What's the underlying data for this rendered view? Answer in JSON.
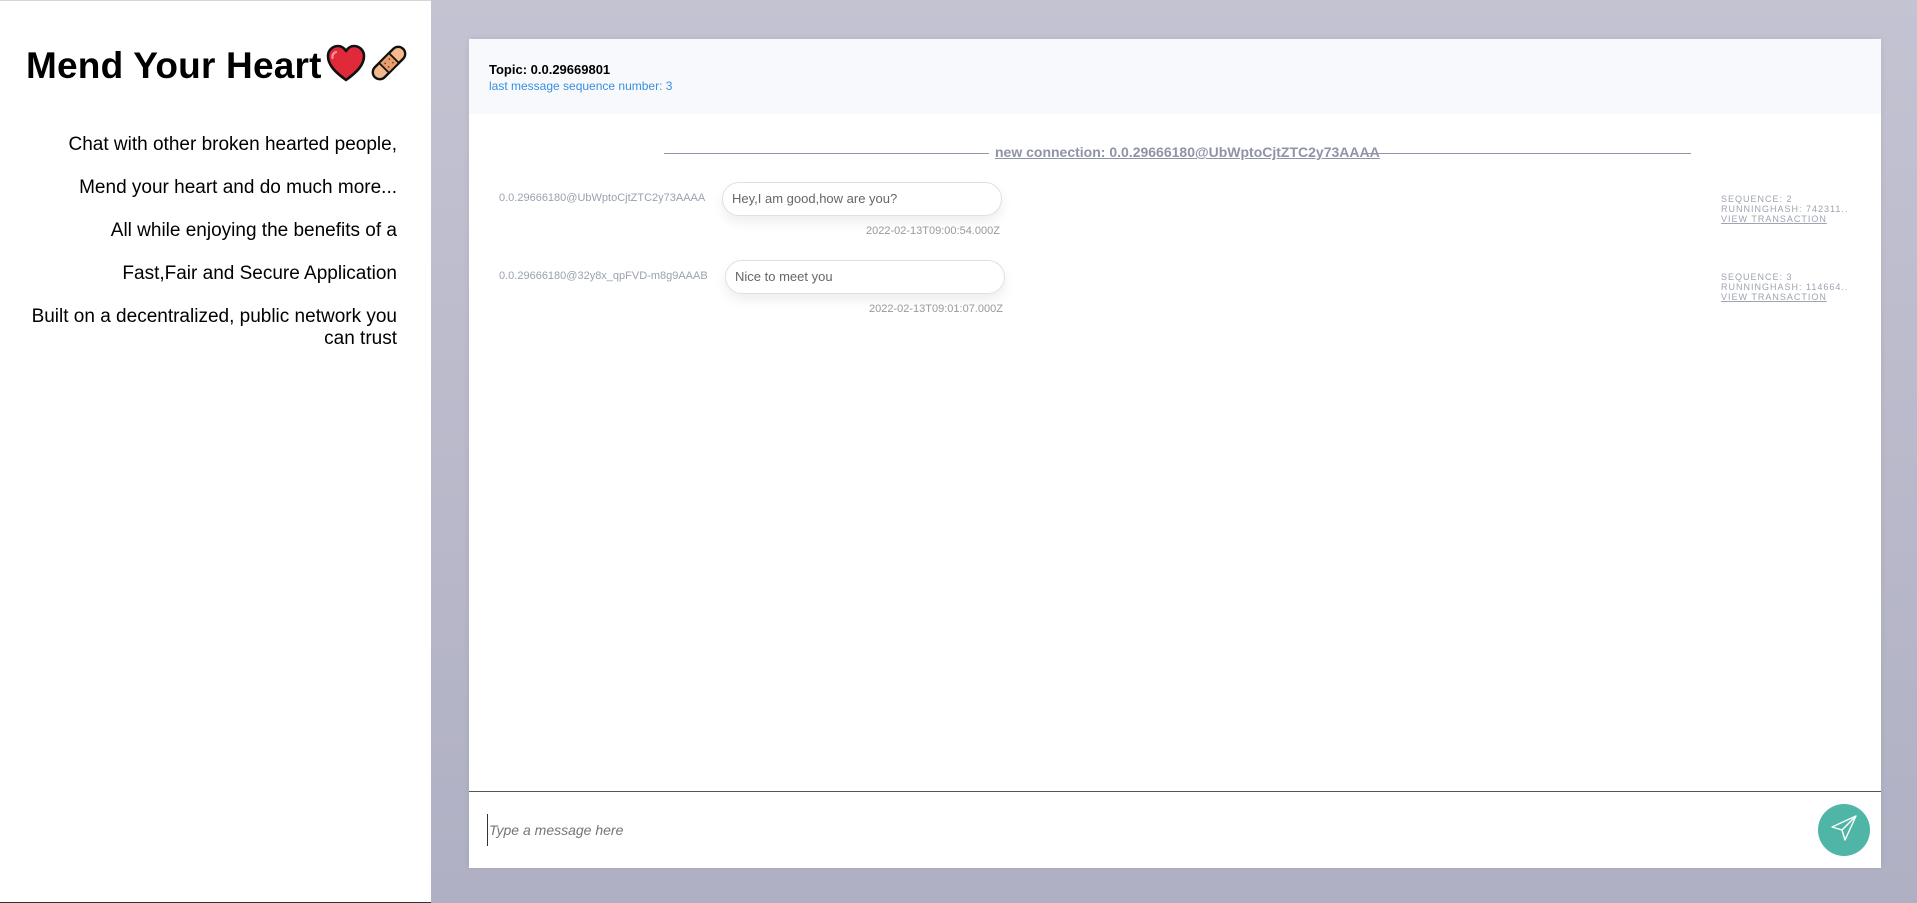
{
  "sidebar": {
    "title": "Mend Your Heart",
    "taglines": [
      "Chat with other broken hearted people,",
      "Mend your heart and do much more...",
      "All while enjoying the benefits of a",
      "Fast,Fair and Secure Application",
      "Built on a decentralized, public network you can trust"
    ],
    "icons": [
      "red-heart-icon",
      "adhesive-bandage-icon"
    ]
  },
  "chat": {
    "topic": "Topic: 0.0.29669801",
    "last_sequence": "last message sequence number: 3",
    "connection": "new connection: 0.0.29666180@UbWptoCjtZTC2y73AAAA",
    "messages": [
      {
        "sender": "0.0.29666180@UbWptoCjtZTC2y73AAAA",
        "text": "Hey,I am good,how are you?",
        "timestamp": "2022-02-13T09:00:54.000Z",
        "sequence": "SEQUENCE: 2",
        "running_hash": "RUNNINGHASH: 742311..",
        "view_link": "VIEW TRANSACTION"
      },
      {
        "sender": "0.0.29666180@32y8x_qpFVD-m8g9AAAB",
        "text": "Nice to meet you",
        "timestamp": "2022-02-13T09:01:07.000Z",
        "sequence": "SEQUENCE: 3",
        "running_hash": "RUNNINGHASH: 114664..",
        "view_link": "VIEW TRANSACTION"
      }
    ],
    "input": {
      "placeholder": "Type a message here",
      "value": ""
    },
    "send_icon": "paper-plane-icon"
  },
  "colors": {
    "accent_send": "#4fb6a7",
    "seq_link": "#3a8fdc",
    "main_bg": "#b8b8cb"
  }
}
